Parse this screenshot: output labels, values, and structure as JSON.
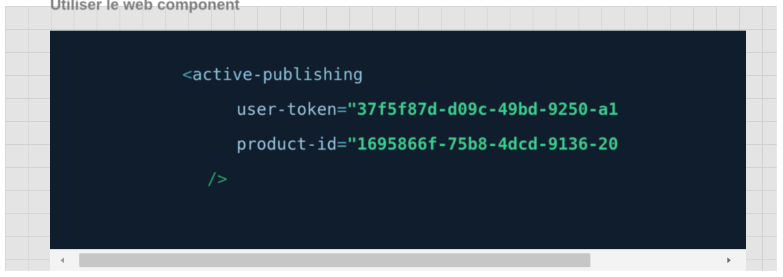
{
  "heading": "Utiliser le web component",
  "code": {
    "open_bracket": "<",
    "tag": "active-publishing",
    "attributes": [
      {
        "name": "user-token",
        "equals": "=",
        "value": "\"37f5f87d-d09c-49bd-9250-a1"
      },
      {
        "name": "product-id",
        "equals": "=",
        "value": "\"1695866f-75b8-4dcd-9136-20"
      }
    ],
    "self_close": "/>"
  },
  "scrollbar": {
    "left_arrow": "left-arrow-icon",
    "right_arrow": "right-arrow-icon",
    "position_fraction": 0.0,
    "visible_fraction": 0.79
  },
  "colors": {
    "panel_background": "#0f1d2c",
    "string": "#3dcd8f",
    "attribute": "#9fc6e0",
    "tag": "#8fc3dd",
    "page_background": "#e4e4e4"
  }
}
